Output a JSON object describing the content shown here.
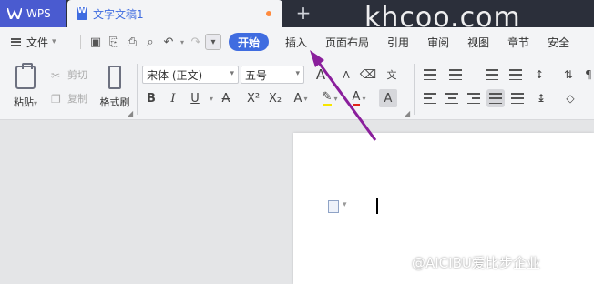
{
  "app": {
    "name": "WPS",
    "accent": "#3f6ce0",
    "titlebar_color": "#2b2f3a"
  },
  "tabs": {
    "document_title": "文字文稿1",
    "add_tab": "+"
  },
  "watermark": "khcoo.com",
  "menu": {
    "file": "文件",
    "tabs": [
      "开始",
      "插入",
      "页面布局",
      "引用",
      "审阅",
      "视图",
      "章节",
      "安全"
    ],
    "active_tab": "开始"
  },
  "ribbon": {
    "paste": "粘贴",
    "cut": "剪切",
    "copy": "复制",
    "format_painter": "格式刷",
    "font_name": "宋体 (正文)",
    "font_size": "五号"
  },
  "annotation": {
    "color": "#8a1f9c",
    "target": "插入"
  },
  "footer_watermark": "@AICIBU爱比步企业"
}
